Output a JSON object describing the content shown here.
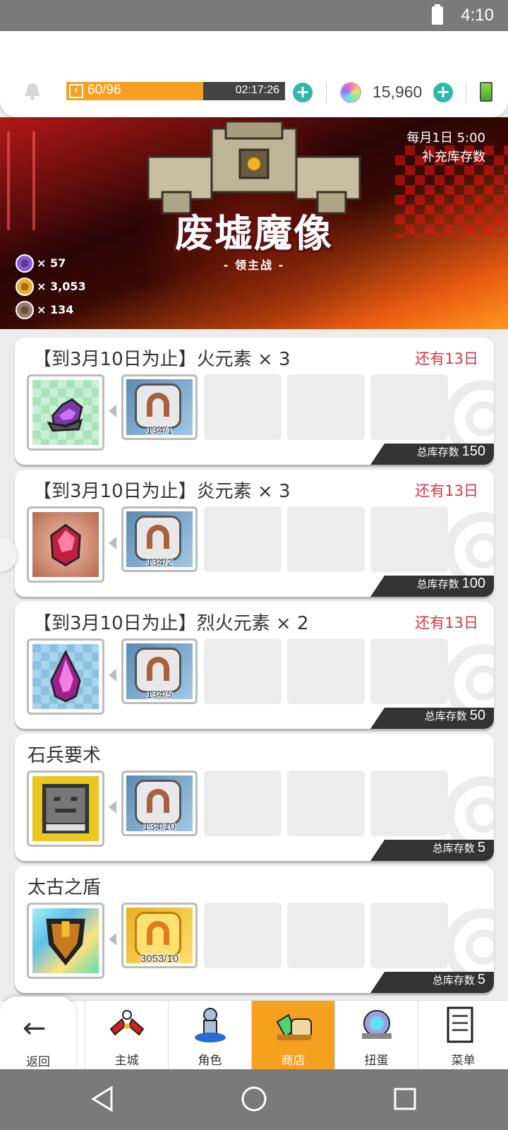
{
  "statusbar": {
    "time": "4:10"
  },
  "topbar": {
    "energy_current": "60",
    "energy_max": "/96",
    "energy_fraction": 0.625,
    "energy_timer": "02:17:26",
    "gems": "15,960"
  },
  "banner": {
    "title": "废墟魔像",
    "subtitle": "- 领主战 -",
    "restock_line1": "每月1日 5:00",
    "restock_line2": "补充库存数",
    "coins": [
      {
        "icon": "purple-coin-icon",
        "color": "#8a5ad6",
        "count": "× 57"
      },
      {
        "icon": "gold-coin-icon",
        "color": "#e8b020",
        "count": "× 3,053"
      },
      {
        "icon": "bronze-coin-icon",
        "color": "#9a7a6a",
        "count": "× 134"
      }
    ]
  },
  "items": [
    {
      "title": "【到3月10日为止】火元素 × 3",
      "remain": "还有13日",
      "cost": "134/1",
      "stock_label": "总库存数",
      "stock": "150",
      "reward_bg": "bg-green",
      "coin": "silver"
    },
    {
      "title": "【到3月10日为止】炎元素 × 3",
      "remain": "还有13日",
      "cost": "134/2",
      "stock_label": "总库存数",
      "stock": "100",
      "reward_bg": "bg-brown",
      "coin": "silver"
    },
    {
      "title": "【到3月10日为止】烈火元素 × 2",
      "remain": "还有13日",
      "cost": "134/5",
      "stock_label": "总库存数",
      "stock": "50",
      "reward_bg": "bg-blue",
      "coin": "silver"
    },
    {
      "title": "石兵要术",
      "remain": "",
      "cost": "134/10",
      "stock_label": "总库存数",
      "stock": "5",
      "reward_bg": "bg-yellow",
      "coin": "silver"
    },
    {
      "title": "太古之盾",
      "remain": "",
      "cost": "3053/10",
      "stock_label": "总库存数",
      "stock": "5",
      "reward_bg": "bg-rainbow",
      "coin": "gold"
    }
  ],
  "nav": {
    "back": "返回",
    "tabs": [
      {
        "label": "主城",
        "icon": "town-icon"
      },
      {
        "label": "角色",
        "icon": "character-icon"
      },
      {
        "label": "商店",
        "icon": "shop-icon",
        "active": true
      },
      {
        "label": "扭蛋",
        "icon": "gacha-icon"
      },
      {
        "label": "菜单",
        "icon": "menu-icon"
      }
    ]
  },
  "colors": {
    "accent": "#f6a020",
    "remain": "#d23a48",
    "energy": "#f5a020"
  }
}
